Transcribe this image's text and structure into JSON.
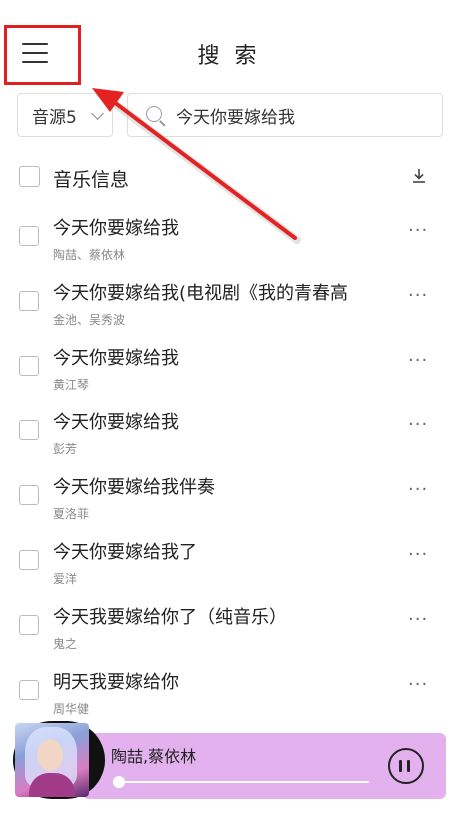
{
  "header": {
    "title": "搜 索"
  },
  "search": {
    "source_label": "音源5",
    "query": "今天你要嫁给我"
  },
  "list": {
    "header_label": "音乐信息",
    "items": [
      {
        "title": "今天你要嫁给我",
        "artist": "陶喆、蔡依林"
      },
      {
        "title": "今天你要嫁给我(电视剧《我的青春高",
        "artist": "金池、吴秀波"
      },
      {
        "title": "今天你要嫁给我",
        "artist": "黄江琴"
      },
      {
        "title": "今天你要嫁给我",
        "artist": "彭芳"
      },
      {
        "title": "今天你要嫁给我伴奏",
        "artist": "夏洛菲"
      },
      {
        "title": "今天你要嫁给我了",
        "artist": "爱洋"
      },
      {
        "title": "今天我要嫁给你了（纯音乐）",
        "artist": "鬼之"
      },
      {
        "title": "明天我要嫁给你",
        "artist": "周华健"
      }
    ],
    "more_glyph": "···"
  },
  "player": {
    "artist": "陶喆,蔡依林",
    "progress": 0.0
  },
  "colors": {
    "player_bg": "#e3b2ee",
    "highlight": "#e02020"
  },
  "icons": [
    "menu-icon",
    "search-icon",
    "chevron-down-icon",
    "download-icon",
    "more-icon",
    "pause-icon"
  ]
}
